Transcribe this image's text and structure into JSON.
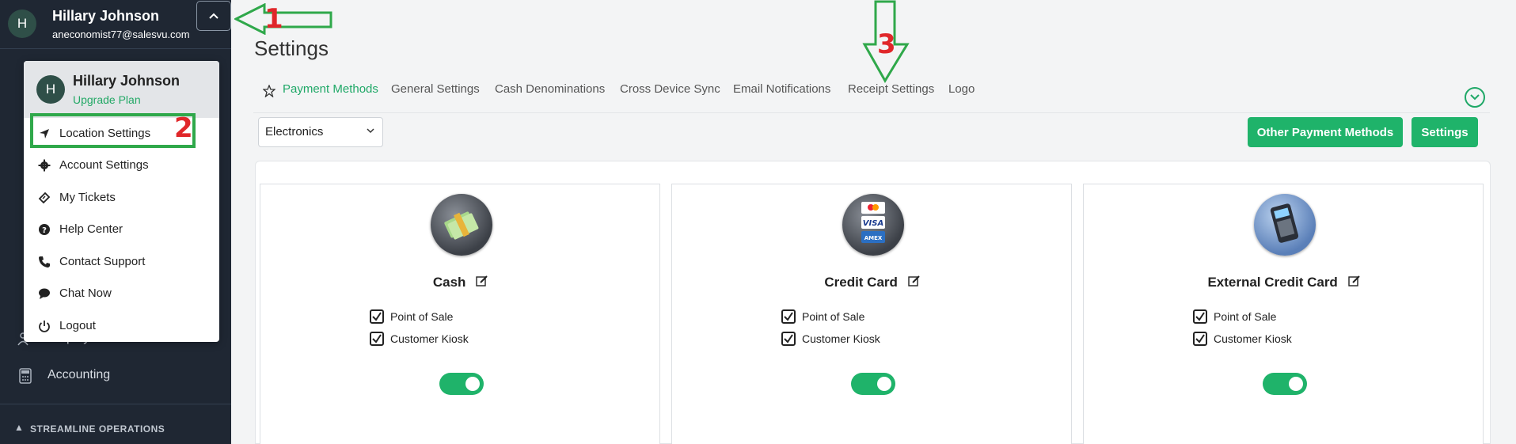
{
  "user": {
    "initial": "H",
    "name": "Hillary Johnson",
    "email": "aneconomist77@salesvu.com",
    "plan_link": "Upgrade Plan"
  },
  "sidebar": {
    "items": [
      {
        "label": "Employees",
        "icon": "people-icon"
      },
      {
        "label": "Accounting",
        "icon": "calculator-icon"
      }
    ],
    "section_label": "STREAMLINE OPERATIONS"
  },
  "user_menu": {
    "items": [
      {
        "label": "Location Settings",
        "icon": "location-arrow-icon"
      },
      {
        "label": "Account Settings",
        "icon": "gear-icon"
      },
      {
        "label": "My Tickets",
        "icon": "ticket-icon"
      },
      {
        "label": "Help Center",
        "icon": "question-circle-icon"
      },
      {
        "label": "Contact Support",
        "icon": "phone-icon"
      },
      {
        "label": "Chat Now",
        "icon": "chat-bubble-icon"
      },
      {
        "label": "Logout",
        "icon": "power-icon"
      }
    ]
  },
  "page": {
    "title": "Settings",
    "tabs": [
      {
        "label": "Payment Methods",
        "active": true
      },
      {
        "label": "General Settings"
      },
      {
        "label": "Cash Denominations"
      },
      {
        "label": "Cross Device Sync"
      },
      {
        "label": "Email Notifications"
      },
      {
        "label": "Receipt Settings"
      },
      {
        "label": "Logo"
      }
    ],
    "location_select": "Electronics",
    "buttons": {
      "other_payment_methods": "Other Payment Methods",
      "settings": "Settings"
    }
  },
  "payment_methods": [
    {
      "name": "Cash",
      "pos_label": "Point of Sale",
      "kiosk_label": "Customer Kiosk",
      "pos_checked": true,
      "kiosk_checked": true,
      "enabled": true
    },
    {
      "name": "Credit Card",
      "pos_label": "Point of Sale",
      "kiosk_label": "Customer Kiosk",
      "pos_checked": true,
      "kiosk_checked": true,
      "enabled": true,
      "card_brands": [
        "VISA",
        "AMEX"
      ]
    },
    {
      "name": "External Credit Card",
      "pos_label": "Point of Sale",
      "kiosk_label": "Customer Kiosk",
      "pos_checked": true,
      "kiosk_checked": true,
      "enabled": true
    }
  ],
  "annotations": [
    "1",
    "2",
    "3"
  ],
  "colors": {
    "accent": "#1fb36a",
    "sidebar_bg": "#1f2733",
    "annotation_arrow": "#2fa84a",
    "annotation_number": "#e0272a"
  }
}
